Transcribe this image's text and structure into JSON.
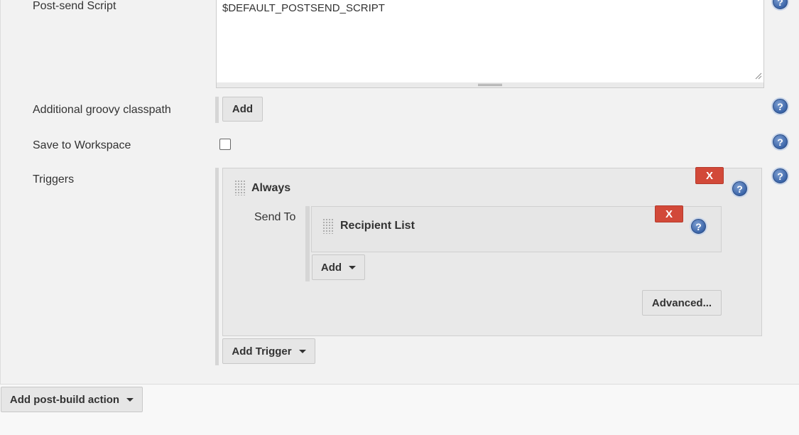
{
  "post_send_script": {
    "label": "Post-send Script",
    "value": "$DEFAULT_POSTSEND_SCRIPT"
  },
  "groovy_classpath": {
    "label": "Additional groovy classpath",
    "add_label": "Add"
  },
  "save_workspace": {
    "label": "Save to Workspace",
    "checked": false
  },
  "triggers": {
    "label": "Triggers",
    "trigger_name": "Always",
    "delete_label": "X",
    "send_to_label": "Send To",
    "recipient": {
      "name": "Recipient List",
      "delete_label": "X"
    },
    "add_label": "Add",
    "advanced_label": "Advanced...",
    "add_trigger_label": "Add Trigger"
  },
  "add_post_build_label": "Add post-build action",
  "help_glyph": "?",
  "colors": {
    "delete": "#d24939",
    "help": "#3a64a8",
    "section_bg": "#f2f2f2"
  },
  "icons": [
    "help-icon",
    "drag-handle-icon",
    "caret-down-icon",
    "resize-grip-icon"
  ]
}
